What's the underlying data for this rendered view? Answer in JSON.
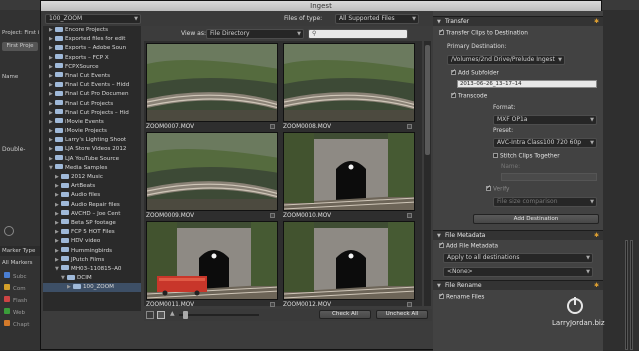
{
  "window": {
    "title": "Ingest"
  },
  "background_app": {
    "project_label": "Project: First i",
    "first_project_label": "First Proje",
    "name_label": "Name",
    "double_label": "Double-",
    "marker_type_label": "Marker Type",
    "all_markers_label": "All Markers",
    "marker_items": [
      "Subc",
      "Com",
      "Flash",
      "Web",
      "Chapt"
    ]
  },
  "browser": {
    "location": "100_ZOOM",
    "files_of_type_label": "Files of type:",
    "files_of_type_value": "All Supported Files",
    "view_as_label": "View as:",
    "view_as_value": "File Directory",
    "search_placeholder": "",
    "tree": [
      {
        "label": "Encore Projects",
        "indent": 1,
        "open": false
      },
      {
        "label": "Exported files for edit",
        "indent": 1,
        "open": false
      },
      {
        "label": "Exports – Adobe Soun",
        "indent": 1,
        "open": false
      },
      {
        "label": "Exports – FCP X",
        "indent": 1,
        "open": false
      },
      {
        "label": "FCPXSource",
        "indent": 1,
        "open": false
      },
      {
        "label": "Final Cut Events",
        "indent": 1,
        "open": false
      },
      {
        "label": "Final Cut Events – Hidd",
        "indent": 1,
        "open": false
      },
      {
        "label": "Final Cut Pro Documen",
        "indent": 1,
        "open": false
      },
      {
        "label": "Final Cut Projects",
        "indent": 1,
        "open": false
      },
      {
        "label": "Final Cut Projects – Hid",
        "indent": 1,
        "open": false
      },
      {
        "label": "iMovie Events",
        "indent": 1,
        "open": false
      },
      {
        "label": "iMovie Projects",
        "indent": 1,
        "open": false
      },
      {
        "label": "Larry's Lighting Shoot",
        "indent": 1,
        "open": false
      },
      {
        "label": "LJA Store Videos 2012",
        "indent": 1,
        "open": false
      },
      {
        "label": "LJA YouTube Source",
        "indent": 1,
        "open": false
      },
      {
        "label": "Media Samples",
        "indent": 1,
        "open": true
      },
      {
        "label": "2012 Music",
        "indent": 2,
        "open": false
      },
      {
        "label": "ArtBeats",
        "indent": 2,
        "open": false
      },
      {
        "label": "Audio files",
        "indent": 2,
        "open": false
      },
      {
        "label": "Audio Repair files",
        "indent": 2,
        "open": false
      },
      {
        "label": "AVCHD – Joe Cent",
        "indent": 2,
        "open": false
      },
      {
        "label": "Beta SP footage",
        "indent": 2,
        "open": false
      },
      {
        "label": "FCP 5 HOT Files",
        "indent": 2,
        "open": false
      },
      {
        "label": "HDV video",
        "indent": 2,
        "open": false
      },
      {
        "label": "Hummingbirds",
        "indent": 2,
        "open": false
      },
      {
        "label": "JPutch Films",
        "indent": 2,
        "open": false
      },
      {
        "label": "MH03–110815–A0",
        "indent": 2,
        "open": true
      },
      {
        "label": "DCIM",
        "indent": 3,
        "open": true
      },
      {
        "label": "100_ZOOM",
        "indent": 4,
        "open": false
      }
    ],
    "clips": [
      {
        "name": "ZOOM0007.MOV",
        "scene": "track"
      },
      {
        "name": "ZOOM0008.MOV",
        "scene": "track"
      },
      {
        "name": "ZOOM0009.MOV",
        "scene": "track"
      },
      {
        "name": "ZOOM0010.MOV",
        "scene": "tunnel"
      },
      {
        "name": "ZOOM0011.MOV",
        "scene": "tunnel-train"
      },
      {
        "name": "ZOOM0012.MOV",
        "scene": "tunnel"
      }
    ],
    "check_all": "Check All",
    "uncheck_all": "Uncheck All"
  },
  "transfer": {
    "header": "Transfer",
    "transfer_clips_label": "Transfer Clips to Destination",
    "transfer_clips_checked": true,
    "primary_destination_label": "Primary Destination:",
    "primary_destination_value": "/Volumes/2nd Drive/Prelude Ingest",
    "add_subfolder_label": "Add Subfolder",
    "add_subfolder_checked": true,
    "subfolder_value": "2013–06–26_13–17–14",
    "transcode_label": "Transcode",
    "transcode_checked": true,
    "format_label": "Format:",
    "format_value": "MXF OP1a",
    "preset_label": "Preset:",
    "preset_value": "AVC-Intra Class100 720 60p",
    "stitch_label": "Stitch Clips Together",
    "stitch_checked": false,
    "name_label": "Name:",
    "verify_label": "Verify",
    "verify_value": "File size comparison",
    "add_destination": "Add Destination"
  },
  "file_metadata": {
    "header": "File Metadata",
    "add_label": "Add File Metadata",
    "add_checked": true,
    "apply_value": "Apply to all destinations",
    "none_value": "<None>"
  },
  "file_rename": {
    "header": "File Rename",
    "rename_label": "Rename Files",
    "rename_checked": true
  },
  "watermark": {
    "site": "LarryJordan.biz"
  },
  "colors": {
    "accent_gear": "#e0a030",
    "folder": "#9fb9d9",
    "marker_colors": [
      "#4a7fd4",
      "#d4a02a",
      "#c44",
      "#3a9d3a",
      "#d47a2a"
    ]
  }
}
